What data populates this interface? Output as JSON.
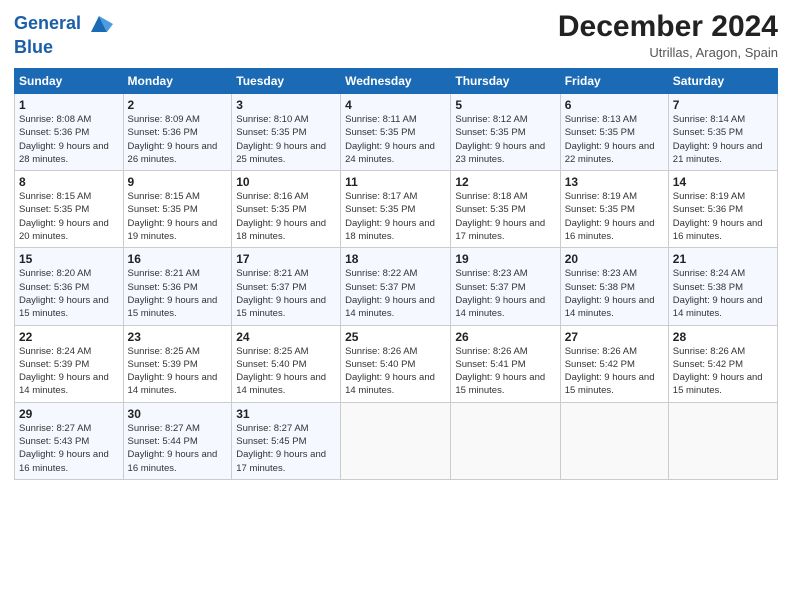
{
  "header": {
    "logo_line1": "General",
    "logo_line2": "Blue",
    "month_title": "December 2024",
    "location": "Utrillas, Aragon, Spain"
  },
  "weekdays": [
    "Sunday",
    "Monday",
    "Tuesday",
    "Wednesday",
    "Thursday",
    "Friday",
    "Saturday"
  ],
  "weeks": [
    [
      {
        "day": "1",
        "sunrise": "8:08 AM",
        "sunset": "5:36 PM",
        "daylight": "9 hours and 28 minutes."
      },
      {
        "day": "2",
        "sunrise": "8:09 AM",
        "sunset": "5:36 PM",
        "daylight": "9 hours and 26 minutes."
      },
      {
        "day": "3",
        "sunrise": "8:10 AM",
        "sunset": "5:35 PM",
        "daylight": "9 hours and 25 minutes."
      },
      {
        "day": "4",
        "sunrise": "8:11 AM",
        "sunset": "5:35 PM",
        "daylight": "9 hours and 24 minutes."
      },
      {
        "day": "5",
        "sunrise": "8:12 AM",
        "sunset": "5:35 PM",
        "daylight": "9 hours and 23 minutes."
      },
      {
        "day": "6",
        "sunrise": "8:13 AM",
        "sunset": "5:35 PM",
        "daylight": "9 hours and 22 minutes."
      },
      {
        "day": "7",
        "sunrise": "8:14 AM",
        "sunset": "5:35 PM",
        "daylight": "9 hours and 21 minutes."
      }
    ],
    [
      {
        "day": "8",
        "sunrise": "8:15 AM",
        "sunset": "5:35 PM",
        "daylight": "9 hours and 20 minutes."
      },
      {
        "day": "9",
        "sunrise": "8:15 AM",
        "sunset": "5:35 PM",
        "daylight": "9 hours and 19 minutes."
      },
      {
        "day": "10",
        "sunrise": "8:16 AM",
        "sunset": "5:35 PM",
        "daylight": "9 hours and 18 minutes."
      },
      {
        "day": "11",
        "sunrise": "8:17 AM",
        "sunset": "5:35 PM",
        "daylight": "9 hours and 18 minutes."
      },
      {
        "day": "12",
        "sunrise": "8:18 AM",
        "sunset": "5:35 PM",
        "daylight": "9 hours and 17 minutes."
      },
      {
        "day": "13",
        "sunrise": "8:19 AM",
        "sunset": "5:35 PM",
        "daylight": "9 hours and 16 minutes."
      },
      {
        "day": "14",
        "sunrise": "8:19 AM",
        "sunset": "5:36 PM",
        "daylight": "9 hours and 16 minutes."
      }
    ],
    [
      {
        "day": "15",
        "sunrise": "8:20 AM",
        "sunset": "5:36 PM",
        "daylight": "9 hours and 15 minutes."
      },
      {
        "day": "16",
        "sunrise": "8:21 AM",
        "sunset": "5:36 PM",
        "daylight": "9 hours and 15 minutes."
      },
      {
        "day": "17",
        "sunrise": "8:21 AM",
        "sunset": "5:37 PM",
        "daylight": "9 hours and 15 minutes."
      },
      {
        "day": "18",
        "sunrise": "8:22 AM",
        "sunset": "5:37 PM",
        "daylight": "9 hours and 14 minutes."
      },
      {
        "day": "19",
        "sunrise": "8:23 AM",
        "sunset": "5:37 PM",
        "daylight": "9 hours and 14 minutes."
      },
      {
        "day": "20",
        "sunrise": "8:23 AM",
        "sunset": "5:38 PM",
        "daylight": "9 hours and 14 minutes."
      },
      {
        "day": "21",
        "sunrise": "8:24 AM",
        "sunset": "5:38 PM",
        "daylight": "9 hours and 14 minutes."
      }
    ],
    [
      {
        "day": "22",
        "sunrise": "8:24 AM",
        "sunset": "5:39 PM",
        "daylight": "9 hours and 14 minutes."
      },
      {
        "day": "23",
        "sunrise": "8:25 AM",
        "sunset": "5:39 PM",
        "daylight": "9 hours and 14 minutes."
      },
      {
        "day": "24",
        "sunrise": "8:25 AM",
        "sunset": "5:40 PM",
        "daylight": "9 hours and 14 minutes."
      },
      {
        "day": "25",
        "sunrise": "8:26 AM",
        "sunset": "5:40 PM",
        "daylight": "9 hours and 14 minutes."
      },
      {
        "day": "26",
        "sunrise": "8:26 AM",
        "sunset": "5:41 PM",
        "daylight": "9 hours and 15 minutes."
      },
      {
        "day": "27",
        "sunrise": "8:26 AM",
        "sunset": "5:42 PM",
        "daylight": "9 hours and 15 minutes."
      },
      {
        "day": "28",
        "sunrise": "8:26 AM",
        "sunset": "5:42 PM",
        "daylight": "9 hours and 15 minutes."
      }
    ],
    [
      {
        "day": "29",
        "sunrise": "8:27 AM",
        "sunset": "5:43 PM",
        "daylight": "9 hours and 16 minutes."
      },
      {
        "day": "30",
        "sunrise": "8:27 AM",
        "sunset": "5:44 PM",
        "daylight": "9 hours and 16 minutes."
      },
      {
        "day": "31",
        "sunrise": "8:27 AM",
        "sunset": "5:45 PM",
        "daylight": "9 hours and 17 minutes."
      },
      null,
      null,
      null,
      null
    ]
  ]
}
